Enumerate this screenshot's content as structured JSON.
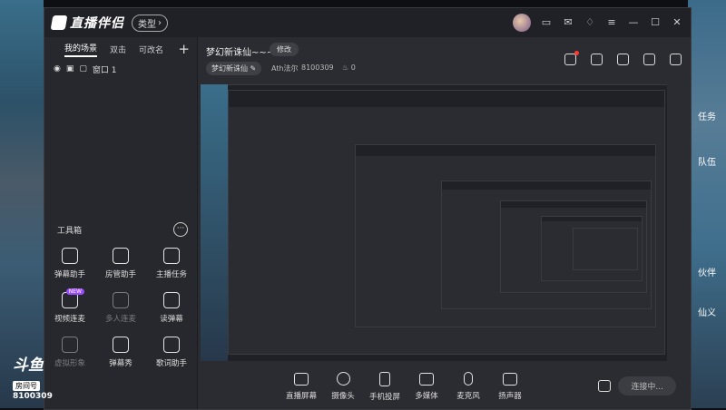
{
  "app": {
    "name": "直播伴侣",
    "type_label": "类型"
  },
  "scenes": {
    "tabs": [
      {
        "label": "我的场景"
      },
      {
        "label": "双击"
      },
      {
        "label": "可改名"
      }
    ],
    "items": [
      {
        "label": "窗口 1"
      }
    ]
  },
  "toolbox": {
    "title": "工具箱",
    "tools": [
      {
        "label": "弹幕助手",
        "icon": "danmaku-icon",
        "dim": false
      },
      {
        "label": "房管助手",
        "icon": "admin-icon",
        "dim": false
      },
      {
        "label": "主播任务",
        "icon": "task-icon",
        "dim": false
      },
      {
        "label": "视频连麦",
        "icon": "video-mic-icon",
        "dim": false,
        "badge": "NEW"
      },
      {
        "label": "多人连麦",
        "icon": "multi-mic-icon",
        "dim": true
      },
      {
        "label": "读弹幕",
        "icon": "read-danmaku-icon",
        "dim": false
      },
      {
        "label": "虚拟形象",
        "icon": "avatar-icon",
        "dim": true
      },
      {
        "label": "弹幕秀",
        "icon": "danmaku-show-icon",
        "dim": false
      },
      {
        "label": "歌词助手",
        "icon": "lyrics-icon",
        "dim": false
      }
    ]
  },
  "header": {
    "title": "梦幻新诛仙~~~",
    "edit_label": "修改",
    "tag": "梦幻新诛仙",
    "streamer": "Ath法尔",
    "room_id": "8100309",
    "likes": "0"
  },
  "bottom": {
    "items": [
      {
        "label": "直播屏幕",
        "icon": "screen-share-icon"
      },
      {
        "label": "摄像头",
        "icon": "camera-icon"
      },
      {
        "label": "手机投屏",
        "icon": "phone-cast-icon"
      },
      {
        "label": "多媒体",
        "icon": "media-icon"
      },
      {
        "label": "麦克风",
        "icon": "microphone-icon"
      },
      {
        "label": "扬声器",
        "icon": "speaker-icon"
      }
    ],
    "start_label": "连接中..."
  },
  "overlay": {
    "platform": "斗鱼",
    "room_label": "房间号",
    "room_id": "8100309",
    "right_menu": [
      "任务",
      "队伍",
      "伙伴",
      "仙义"
    ]
  },
  "colors": {
    "accent": "#9b4bff",
    "panel": "#2b2c31",
    "dark": "#202126"
  }
}
